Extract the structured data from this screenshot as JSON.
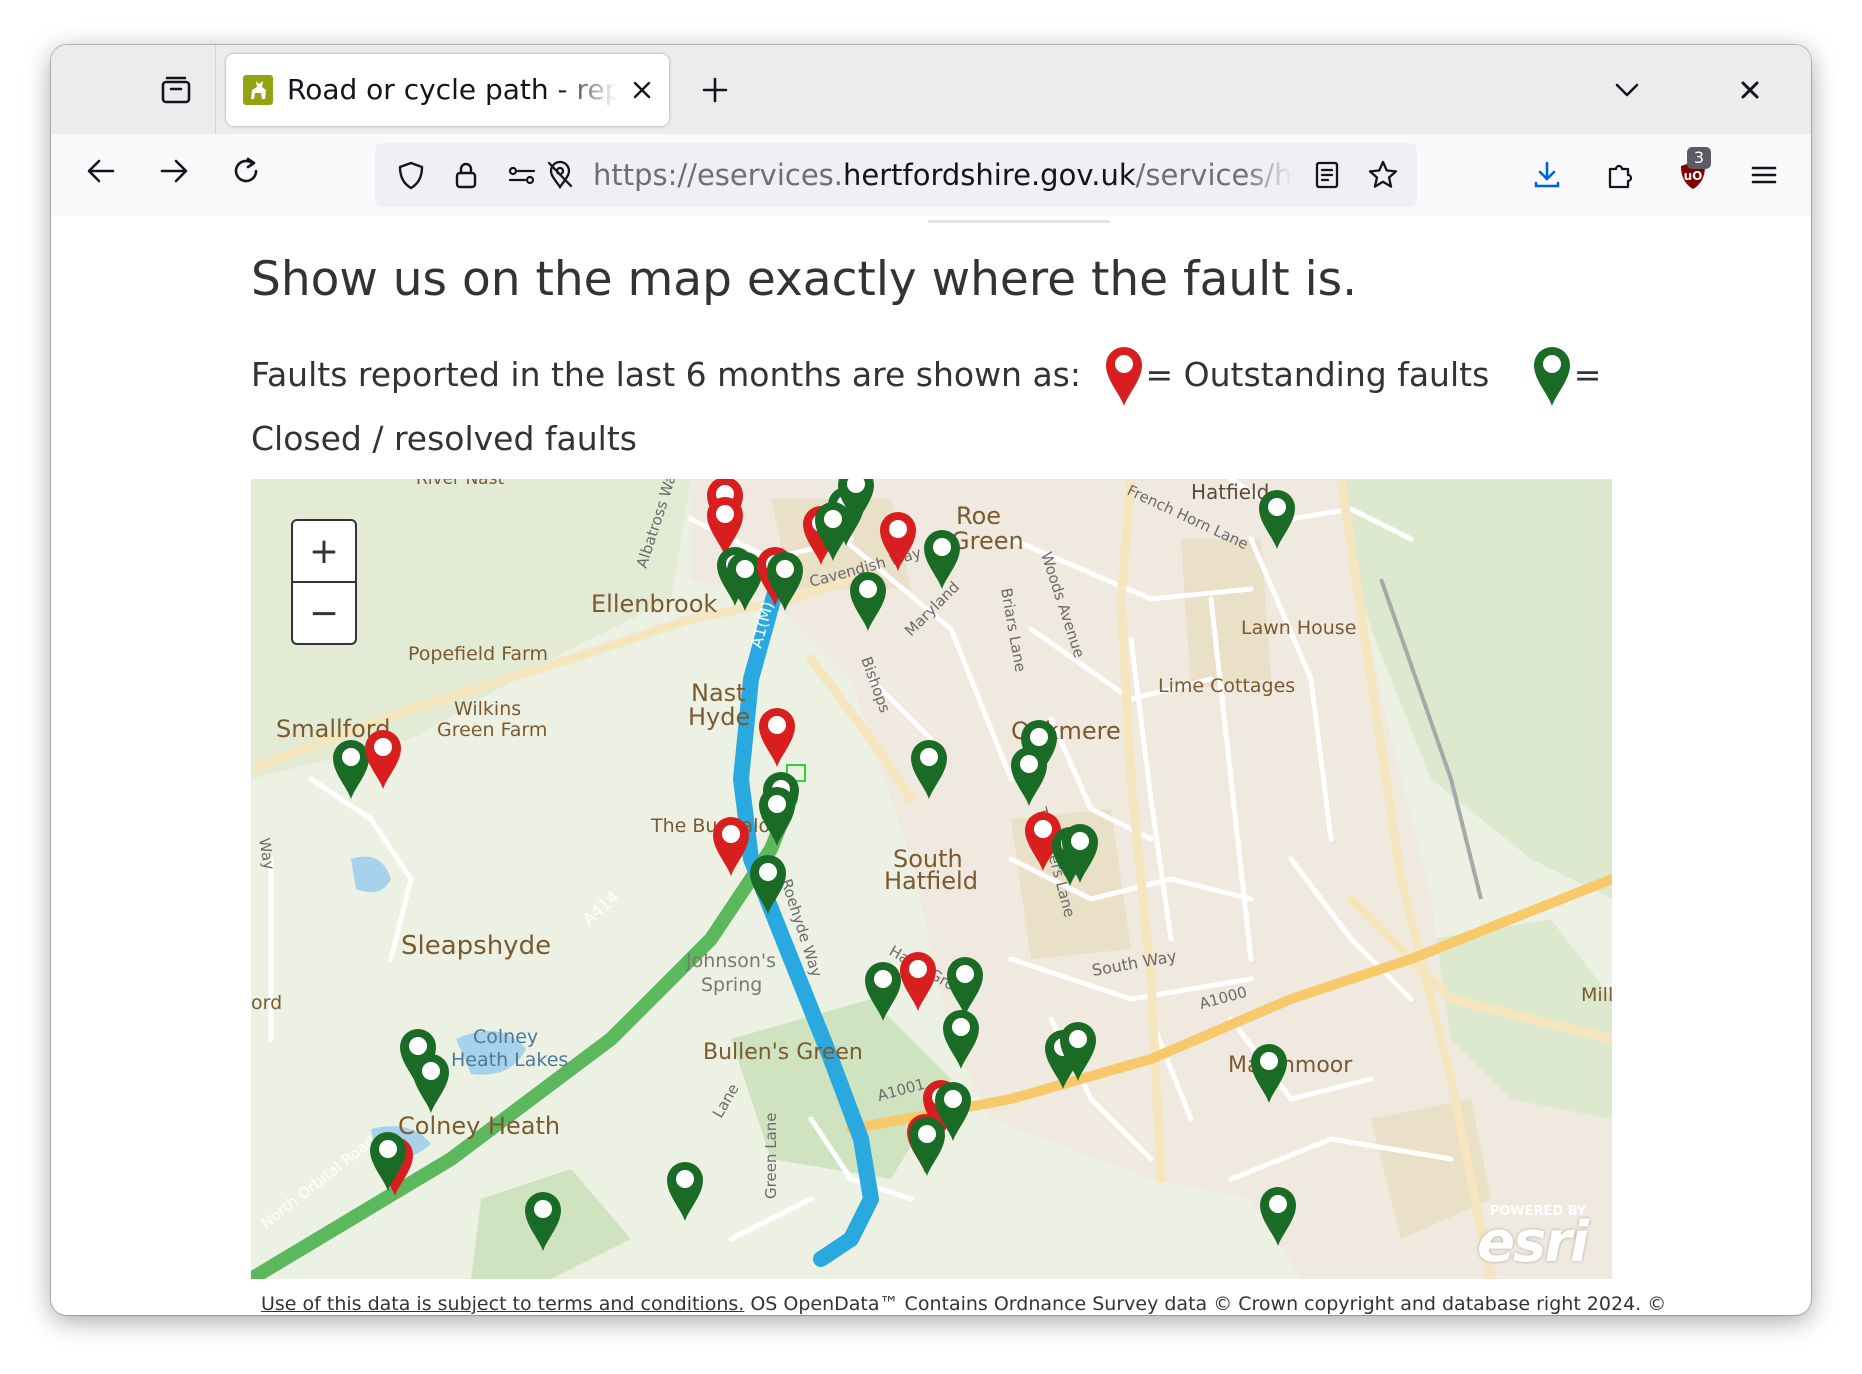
{
  "browser": {
    "tab_title": "Road or cycle path - report a fault",
    "url_prefix": "https://eservices.",
    "url_host": "hertfordshire.gov.uk",
    "url_path": "/services/hidden",
    "extension_badge": "3"
  },
  "page": {
    "heading": "Show us on the map exactly where the fault is.",
    "legend_intro": "Faults reported in the last 6 months are shown as:",
    "legend_outstanding": "= Outstanding faults",
    "legend_closed": "= Closed / resolved faults",
    "attribution_link": "Use of this data is subject to terms and conditions.",
    "attribution_text": " OS OpenData™ Contains Ordnance Survey data © Crown copyright and database right 2024. ©"
  },
  "map": {
    "zoom_in": "+",
    "zoom_out": "−",
    "esri_small": "POWERED BY",
    "esri_main": "esri",
    "colors": {
      "outstanding": "#d81e1e",
      "closed": "#1a6b25",
      "motorway": "#29a9e0",
      "a_road": "#5cb85c"
    },
    "labels": [
      {
        "id": "river-nast",
        "text": "River Nast"
      },
      {
        "id": "hatfield",
        "text": "Hatfield"
      },
      {
        "id": "french-horn-lane",
        "text": "French Horn Lane"
      },
      {
        "id": "roe-green-1",
        "text": "Roe"
      },
      {
        "id": "roe-green-2",
        "text": "Green"
      },
      {
        "id": "albatross-way",
        "text": "Albatross Way"
      },
      {
        "id": "ellenbrook",
        "text": "Ellenbrook"
      },
      {
        "id": "a1m",
        "text": "A1(M)"
      },
      {
        "id": "cavendish-way",
        "text": "Cavendish Way"
      },
      {
        "id": "maryland",
        "text": "Maryland"
      },
      {
        "id": "briars-lane",
        "text": "Briars Lane"
      },
      {
        "id": "woods-avenue",
        "text": "Woods Avenue"
      },
      {
        "id": "lawn-house",
        "text": "Lawn House"
      },
      {
        "id": "popefield-farm",
        "text": "Popefield Farm"
      },
      {
        "id": "lime-cottages",
        "text": "Lime Cottages"
      },
      {
        "id": "nast",
        "text": "Nast"
      },
      {
        "id": "hyde",
        "text": "Hyde"
      },
      {
        "id": "wilkins",
        "text": "Wilkins"
      },
      {
        "id": "green-farm",
        "text": "Green Farm"
      },
      {
        "id": "bishops",
        "text": "Bishops"
      },
      {
        "id": "smallford",
        "text": "Smallford"
      },
      {
        "id": "oakmere",
        "text": "Oakmere"
      },
      {
        "id": "the-bungalow",
        "text": "The Bungalow"
      },
      {
        "id": "south",
        "text": "South"
      },
      {
        "id": "hatfield-2",
        "text": "Hatfield"
      },
      {
        "id": "travellers-lane",
        "text": "Travellers Lane"
      },
      {
        "id": "a414",
        "text": "A414"
      },
      {
        "id": "roehyde-way",
        "text": "Roehyde Way"
      },
      {
        "id": "sleapshyde",
        "text": "Sleapshyde"
      },
      {
        "id": "johnsons",
        "text": "Johnson's"
      },
      {
        "id": "spring",
        "text": "Spring"
      },
      {
        "id": "hazel-grove",
        "text": "Hazel Grove"
      },
      {
        "id": "south-way",
        "text": "South Way"
      },
      {
        "id": "a1000",
        "text": "A1000"
      },
      {
        "id": "mill",
        "text": "Mill"
      },
      {
        "id": "ord",
        "text": "ord"
      },
      {
        "id": "colney",
        "text": "Colney"
      },
      {
        "id": "heath-lakes",
        "text": "Heath Lakes"
      },
      {
        "id": "bullens-green",
        "text": "Bullen's Green"
      },
      {
        "id": "marshmoor",
        "text": "Marshmoor"
      },
      {
        "id": "north-orbital-road",
        "text": "North Orbital Road"
      },
      {
        "id": "a1001",
        "text": "A1001"
      },
      {
        "id": "colney-heath",
        "text": "Colney Heath"
      },
      {
        "id": "lane",
        "text": "Lane"
      },
      {
        "id": "green-lane",
        "text": "Green Lane"
      },
      {
        "id": "way-left",
        "text": "Way"
      }
    ]
  }
}
